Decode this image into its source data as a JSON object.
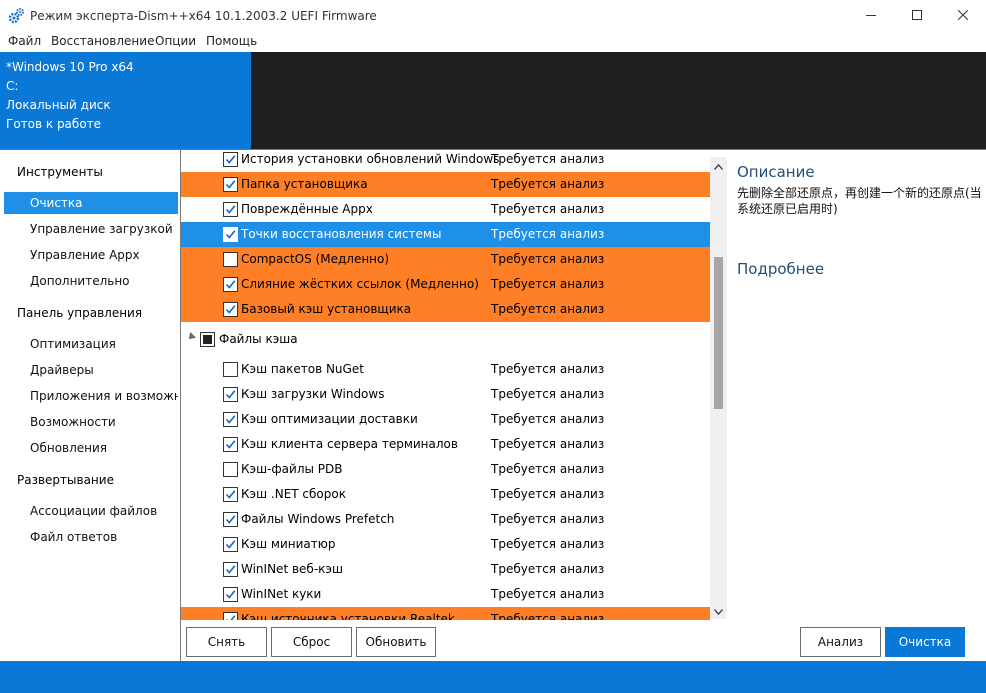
{
  "window": {
    "title": "Режим эксперта-Dism++x64 10.1.2003.2 UEFI Firmware"
  },
  "menu": [
    "Файл",
    "Восстановление",
    "Опции",
    "Помощь"
  ],
  "header": {
    "os": "*Windows 10 Pro x64",
    "drive": "C:",
    "disk": "Локальный диск",
    "status": "Готов к работе"
  },
  "nav": {
    "groups": {
      "tools": "Инструменты",
      "control": "Панель управления",
      "deploy": "Развертывание"
    },
    "items": {
      "cleanup": "Очистка",
      "boot": "Управление загрузкой",
      "appx": "Управление Appx",
      "advanced": "Дополнительно",
      "optimization": "Оптимизация",
      "drivers": "Драйверы",
      "apps": "Приложения и возможнос",
      "features": "Возможности",
      "updates": "Обновления",
      "file_assoc": "Ассоциации файлов",
      "answer_file": "Файл ответов"
    }
  },
  "list": {
    "rows_top": [
      {
        "name": "История установки обновлений Windows",
        "status": "Требуется анализ",
        "checked": true,
        "style": "plain"
      },
      {
        "name": "Папка установщика",
        "status": "Требуется анализ",
        "checked": true,
        "style": "orange"
      },
      {
        "name": "Повреждённые Appx",
        "status": "Требуется анализ",
        "checked": true,
        "style": "plain"
      },
      {
        "name": "Точки восстановления системы",
        "status": "Требуется анализ",
        "checked": true,
        "style": "blue"
      },
      {
        "name": "CompactOS (Медленно)",
        "status": "Требуется анализ",
        "checked": false,
        "style": "orange"
      },
      {
        "name": "Слияние жёстких ссылок (Медленно)",
        "status": "Требуется анализ",
        "checked": true,
        "style": "orange"
      },
      {
        "name": "Базовый кэш установщика",
        "status": "Требуется анализ",
        "checked": true,
        "style": "orange"
      }
    ],
    "group": {
      "name": "Файлы кэша"
    },
    "rows_cache": [
      {
        "name": "Кэш пакетов NuGet",
        "status": "Требуется анализ",
        "checked": false,
        "style": "plain"
      },
      {
        "name": "Кэш загрузки Windows",
        "status": "Требуется анализ",
        "checked": true,
        "style": "plain"
      },
      {
        "name": "Кэш оптимизации доставки",
        "status": "Требуется анализ",
        "checked": true,
        "style": "plain"
      },
      {
        "name": "Кэш клиента сервера терминалов",
        "status": "Требуется анализ",
        "checked": true,
        "style": "plain"
      },
      {
        "name": "Кэш-файлы PDB",
        "status": "Требуется анализ",
        "checked": false,
        "style": "plain"
      },
      {
        "name": "Кэш .NET сборок",
        "status": "Требуется анализ",
        "checked": true,
        "style": "plain"
      },
      {
        "name": "Файлы Windows Prefetch",
        "status": "Требуется анализ",
        "checked": true,
        "style": "plain"
      },
      {
        "name": "Кэш миниатюр",
        "status": "Требуется анализ",
        "checked": true,
        "style": "plain"
      },
      {
        "name": "WinINet веб-кэш",
        "status": "Требуется анализ",
        "checked": true,
        "style": "plain"
      },
      {
        "name": "WinINet куки",
        "status": "Требуется анализ",
        "checked": true,
        "style": "plain"
      },
      {
        "name": "Кэш источника установки Realtek",
        "status": "Требуется анализ",
        "checked": true,
        "style": "orange"
      }
    ]
  },
  "right": {
    "desc_title": "Описание",
    "desc_text": "先删除全部还原点，再创建一个新的还原点(当系统还原已启用时)",
    "more_title": "Подробнее"
  },
  "buttons": {
    "remove": "Снять",
    "reset": "Сброс",
    "refresh": "Обновить",
    "analyze": "Анализ",
    "clean": "Очистка"
  },
  "colors": {
    "accent": "#0a78d7",
    "selection": "#1e90e8",
    "highlight": "#ff7f27",
    "dark": "#1f1f1f"
  }
}
